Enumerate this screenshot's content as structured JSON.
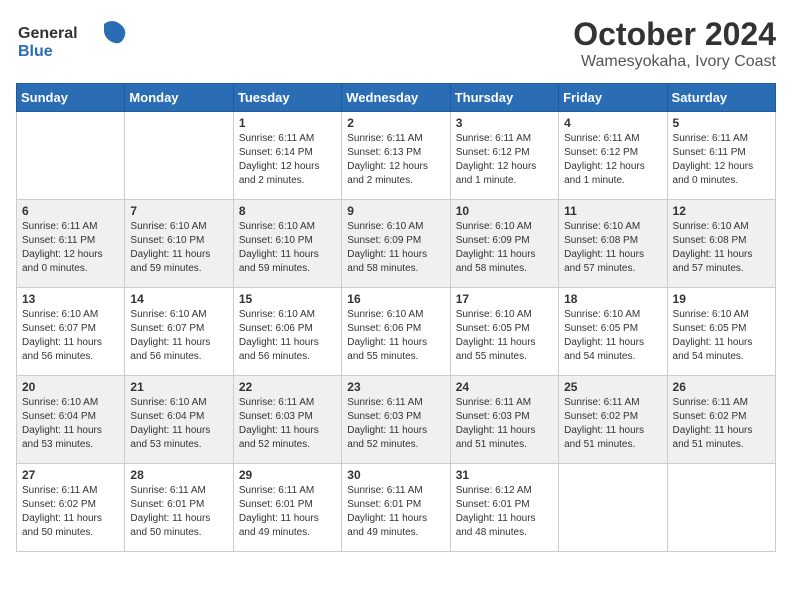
{
  "header": {
    "logo_general": "General",
    "logo_blue": "Blue",
    "month": "October 2024",
    "location": "Wamesyokaha, Ivory Coast"
  },
  "weekdays": [
    "Sunday",
    "Monday",
    "Tuesday",
    "Wednesday",
    "Thursday",
    "Friday",
    "Saturday"
  ],
  "weeks": [
    [
      {
        "day": "",
        "sunrise": "",
        "sunset": "",
        "daylight": ""
      },
      {
        "day": "",
        "sunrise": "",
        "sunset": "",
        "daylight": ""
      },
      {
        "day": "1",
        "sunrise": "Sunrise: 6:11 AM",
        "sunset": "Sunset: 6:14 PM",
        "daylight": "Daylight: 12 hours and 2 minutes."
      },
      {
        "day": "2",
        "sunrise": "Sunrise: 6:11 AM",
        "sunset": "Sunset: 6:13 PM",
        "daylight": "Daylight: 12 hours and 2 minutes."
      },
      {
        "day": "3",
        "sunrise": "Sunrise: 6:11 AM",
        "sunset": "Sunset: 6:12 PM",
        "daylight": "Daylight: 12 hours and 1 minute."
      },
      {
        "day": "4",
        "sunrise": "Sunrise: 6:11 AM",
        "sunset": "Sunset: 6:12 PM",
        "daylight": "Daylight: 12 hours and 1 minute."
      },
      {
        "day": "5",
        "sunrise": "Sunrise: 6:11 AM",
        "sunset": "Sunset: 6:11 PM",
        "daylight": "Daylight: 12 hours and 0 minutes."
      }
    ],
    [
      {
        "day": "6",
        "sunrise": "Sunrise: 6:11 AM",
        "sunset": "Sunset: 6:11 PM",
        "daylight": "Daylight: 12 hours and 0 minutes."
      },
      {
        "day": "7",
        "sunrise": "Sunrise: 6:10 AM",
        "sunset": "Sunset: 6:10 PM",
        "daylight": "Daylight: 11 hours and 59 minutes."
      },
      {
        "day": "8",
        "sunrise": "Sunrise: 6:10 AM",
        "sunset": "Sunset: 6:10 PM",
        "daylight": "Daylight: 11 hours and 59 minutes."
      },
      {
        "day": "9",
        "sunrise": "Sunrise: 6:10 AM",
        "sunset": "Sunset: 6:09 PM",
        "daylight": "Daylight: 11 hours and 58 minutes."
      },
      {
        "day": "10",
        "sunrise": "Sunrise: 6:10 AM",
        "sunset": "Sunset: 6:09 PM",
        "daylight": "Daylight: 11 hours and 58 minutes."
      },
      {
        "day": "11",
        "sunrise": "Sunrise: 6:10 AM",
        "sunset": "Sunset: 6:08 PM",
        "daylight": "Daylight: 11 hours and 57 minutes."
      },
      {
        "day": "12",
        "sunrise": "Sunrise: 6:10 AM",
        "sunset": "Sunset: 6:08 PM",
        "daylight": "Daylight: 11 hours and 57 minutes."
      }
    ],
    [
      {
        "day": "13",
        "sunrise": "Sunrise: 6:10 AM",
        "sunset": "Sunset: 6:07 PM",
        "daylight": "Daylight: 11 hours and 56 minutes."
      },
      {
        "day": "14",
        "sunrise": "Sunrise: 6:10 AM",
        "sunset": "Sunset: 6:07 PM",
        "daylight": "Daylight: 11 hours and 56 minutes."
      },
      {
        "day": "15",
        "sunrise": "Sunrise: 6:10 AM",
        "sunset": "Sunset: 6:06 PM",
        "daylight": "Daylight: 11 hours and 56 minutes."
      },
      {
        "day": "16",
        "sunrise": "Sunrise: 6:10 AM",
        "sunset": "Sunset: 6:06 PM",
        "daylight": "Daylight: 11 hours and 55 minutes."
      },
      {
        "day": "17",
        "sunrise": "Sunrise: 6:10 AM",
        "sunset": "Sunset: 6:05 PM",
        "daylight": "Daylight: 11 hours and 55 minutes."
      },
      {
        "day": "18",
        "sunrise": "Sunrise: 6:10 AM",
        "sunset": "Sunset: 6:05 PM",
        "daylight": "Daylight: 11 hours and 54 minutes."
      },
      {
        "day": "19",
        "sunrise": "Sunrise: 6:10 AM",
        "sunset": "Sunset: 6:05 PM",
        "daylight": "Daylight: 11 hours and 54 minutes."
      }
    ],
    [
      {
        "day": "20",
        "sunrise": "Sunrise: 6:10 AM",
        "sunset": "Sunset: 6:04 PM",
        "daylight": "Daylight: 11 hours and 53 minutes."
      },
      {
        "day": "21",
        "sunrise": "Sunrise: 6:10 AM",
        "sunset": "Sunset: 6:04 PM",
        "daylight": "Daylight: 11 hours and 53 minutes."
      },
      {
        "day": "22",
        "sunrise": "Sunrise: 6:11 AM",
        "sunset": "Sunset: 6:03 PM",
        "daylight": "Daylight: 11 hours and 52 minutes."
      },
      {
        "day": "23",
        "sunrise": "Sunrise: 6:11 AM",
        "sunset": "Sunset: 6:03 PM",
        "daylight": "Daylight: 11 hours and 52 minutes."
      },
      {
        "day": "24",
        "sunrise": "Sunrise: 6:11 AM",
        "sunset": "Sunset: 6:03 PM",
        "daylight": "Daylight: 11 hours and 51 minutes."
      },
      {
        "day": "25",
        "sunrise": "Sunrise: 6:11 AM",
        "sunset": "Sunset: 6:02 PM",
        "daylight": "Daylight: 11 hours and 51 minutes."
      },
      {
        "day": "26",
        "sunrise": "Sunrise: 6:11 AM",
        "sunset": "Sunset: 6:02 PM",
        "daylight": "Daylight: 11 hours and 51 minutes."
      }
    ],
    [
      {
        "day": "27",
        "sunrise": "Sunrise: 6:11 AM",
        "sunset": "Sunset: 6:02 PM",
        "daylight": "Daylight: 11 hours and 50 minutes."
      },
      {
        "day": "28",
        "sunrise": "Sunrise: 6:11 AM",
        "sunset": "Sunset: 6:01 PM",
        "daylight": "Daylight: 11 hours and 50 minutes."
      },
      {
        "day": "29",
        "sunrise": "Sunrise: 6:11 AM",
        "sunset": "Sunset: 6:01 PM",
        "daylight": "Daylight: 11 hours and 49 minutes."
      },
      {
        "day": "30",
        "sunrise": "Sunrise: 6:11 AM",
        "sunset": "Sunset: 6:01 PM",
        "daylight": "Daylight: 11 hours and 49 minutes."
      },
      {
        "day": "31",
        "sunrise": "Sunrise: 6:12 AM",
        "sunset": "Sunset: 6:01 PM",
        "daylight": "Daylight: 11 hours and 48 minutes."
      },
      {
        "day": "",
        "sunrise": "",
        "sunset": "",
        "daylight": ""
      },
      {
        "day": "",
        "sunrise": "",
        "sunset": "",
        "daylight": ""
      }
    ]
  ]
}
